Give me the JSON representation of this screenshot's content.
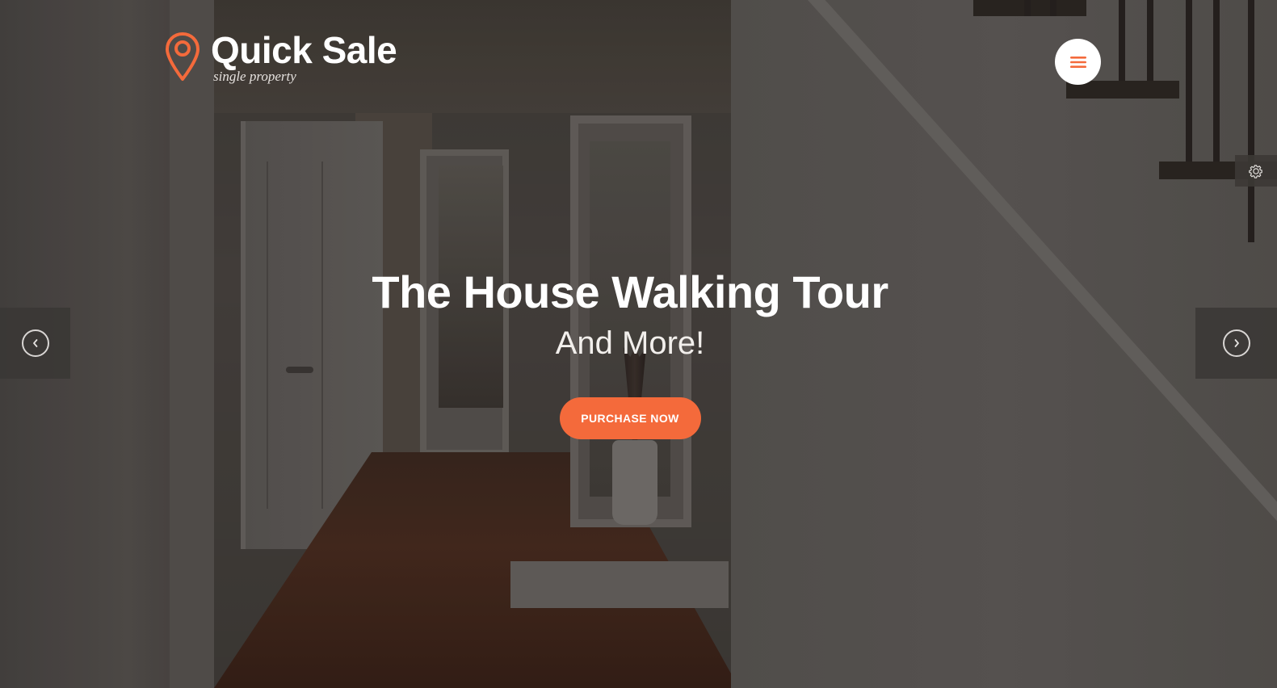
{
  "brand": {
    "title": "Quick Sale",
    "tagline": "single property",
    "accent_color": "#f46a3b",
    "logo_icon": "map-pin-icon"
  },
  "header": {
    "menu_icon": "hamburger-menu-icon",
    "settings_icon": "gear-icon"
  },
  "hero": {
    "title": "The House Walking Tour",
    "subtitle": "And More!",
    "cta_label": "PURCHASE NOW",
    "background": "hallway-interior-photo"
  },
  "slider": {
    "prev_icon": "chevron-left-icon",
    "next_icon": "chevron-right-icon"
  }
}
